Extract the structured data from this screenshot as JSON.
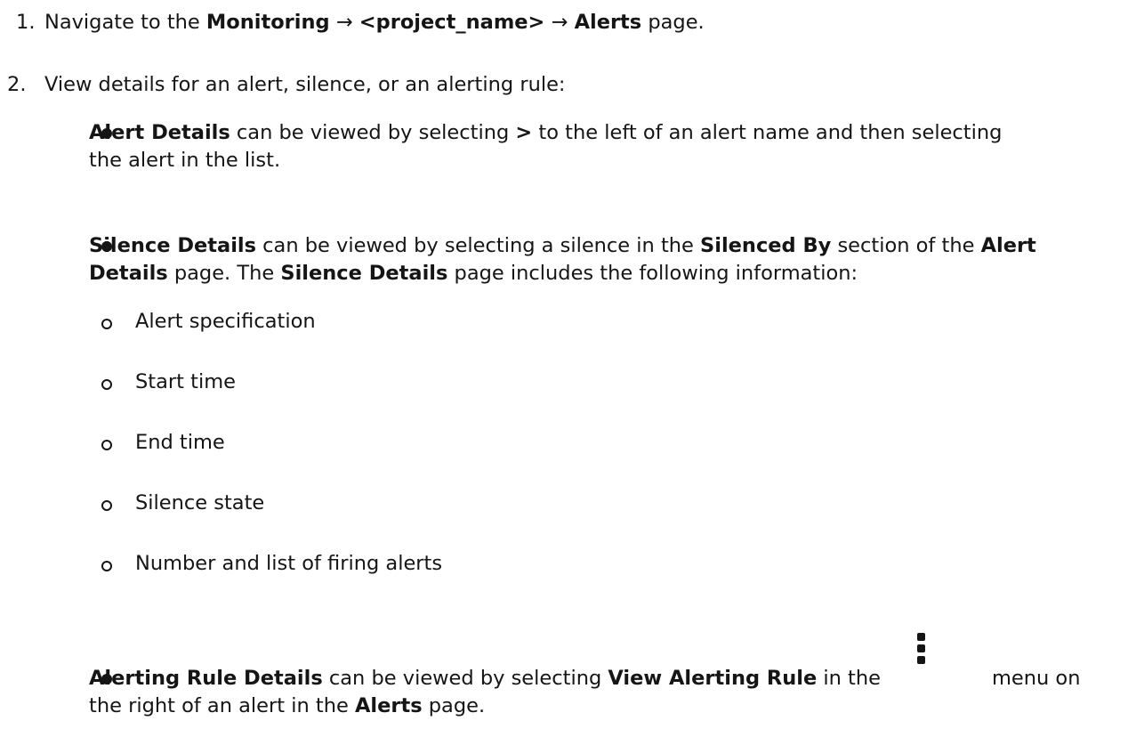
{
  "steps": [
    {
      "number": "1.",
      "parts": {
        "p1": "Navigate to the ",
        "b1": "Monitoring",
        "arrow1": " → ",
        "b2": "<project_name>",
        "arrow2": " → ",
        "b3": "Alerts",
        "p2": " page."
      }
    },
    {
      "number": "2.",
      "text": "View details for an alert, silence, or an alerting rule:"
    }
  ],
  "bullets": {
    "alert_details": {
      "b1": "Alert Details",
      "p1": " can be viewed by selecting ",
      "chevron": ">",
      "p2": " to the left of an alert name and then selecting",
      "line2": "the alert in the list."
    },
    "silence_details": {
      "b1": "Silence Details",
      "p1": " can be viewed by selecting a silence in the ",
      "b2": "Silenced By",
      "p2": " section of the ",
      "b3": "Alert",
      "b4": "Details",
      "p3": " page. The ",
      "b5": "Silence Details",
      "p4": " page includes the following information:",
      "items": [
        "Alert specification",
        "Start time",
        "End time",
        "Silence state",
        "Number and list of firing alerts"
      ]
    },
    "alerting_rule_details": {
      "b1": "Alerting Rule Details",
      "p1": " can be viewed by selecting ",
      "b2": "View Alerting Rule",
      "p2": " in the",
      "kebab_icon": "kebab-vertical-icon",
      "p3": "menu on",
      "line2_p1": "the right of an alert in the ",
      "line2_b1": "Alerts",
      "line2_p2": " page."
    }
  }
}
